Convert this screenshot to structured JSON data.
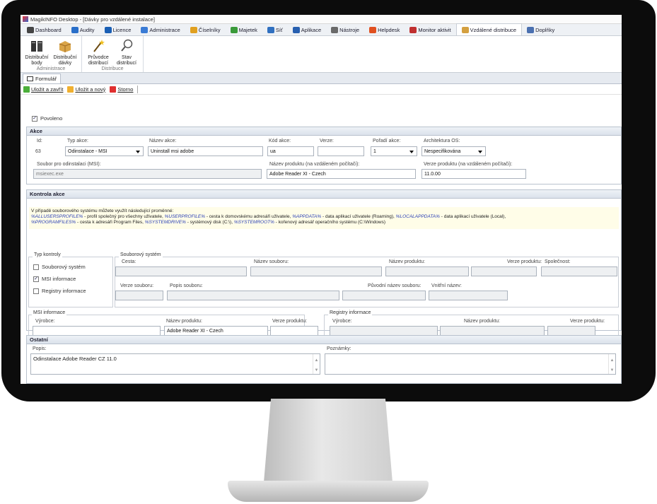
{
  "window": {
    "title": "MagikINFO Desktop - [Dávky pro vzdálené instalace]"
  },
  "tabs": [
    {
      "label": "Dashboard",
      "color": "#444444"
    },
    {
      "label": "Audity",
      "color": "#2a6fc9"
    },
    {
      "label": "Licence",
      "color": "#1a5fb4"
    },
    {
      "label": "Administrace",
      "color": "#3a7bd5"
    },
    {
      "label": "Číselníky",
      "color": "#e0a020"
    },
    {
      "label": "Majetek",
      "color": "#3a9a3a"
    },
    {
      "label": "Síť",
      "color": "#3070c0"
    },
    {
      "label": "Aplikace",
      "color": "#2860b0"
    },
    {
      "label": "Nástroje",
      "color": "#6a6a6a"
    },
    {
      "label": "Helpdesk",
      "color": "#e05020"
    },
    {
      "label": "Monitor aktivit",
      "color": "#c03030"
    },
    {
      "label": "Vzdálené distribuce",
      "color": "#d4a040"
    },
    {
      "label": "Doplňky",
      "color": "#4a70b0"
    }
  ],
  "active_tab": "Vzdálené distribuce",
  "ribbon": {
    "groups": [
      {
        "name": "Administrace",
        "buttons": [
          {
            "label": "Distribuční body",
            "icon": "server-icon"
          },
          {
            "label": "Distribuční dávky",
            "icon": "package-icon"
          }
        ]
      },
      {
        "name": "Distribuce",
        "buttons": [
          {
            "label": "Průvodce distribucí",
            "icon": "wand-icon"
          },
          {
            "label": "Stav distribucí",
            "icon": "magnifier-icon"
          }
        ]
      }
    ]
  },
  "doc_tab": "Formulář",
  "toolbar": {
    "save_close": "Uložit a zavřít",
    "save_new": "Uložit a nový",
    "cancel": "Storno"
  },
  "enabled": {
    "label": "Povoleno",
    "checked": true
  },
  "akce": {
    "header": "Akce",
    "labels": {
      "id": "Id:",
      "type": "Typ akce:",
      "name": "Název akce:",
      "code": "Kód akce:",
      "version": "Verze:",
      "order": "Pořadí akce:",
      "arch": "Architektura OS:",
      "msi_file": "Soubor pro odinstalaci (MSI):",
      "product_name": "Název produktu (na vzdáleném počítači):",
      "product_version": "Verze produktu (na vzdáleném počítači):"
    },
    "values": {
      "id": "63",
      "type": "Odinstalace - MSI",
      "name": "Uninstall msi adobe",
      "code": "ua",
      "version": "",
      "order": "1",
      "arch": "Nespecifikována",
      "msi_file": "msiexec.exe",
      "product_name": "Adobe Reader XI - Czech",
      "product_version": "11.0.00"
    }
  },
  "kontrola": {
    "header": "Kontrola akce",
    "note": {
      "line1": "V případě souborového systému můžete využít následující proměnné:",
      "v1": "%ALLUSERSPROFILE%",
      "t1": " - profil společný pro všechny uživatele, ",
      "v2": "%USERPROFILE%",
      "t2": " - cesta k domovskému adresáři uživatele, ",
      "v3": "%APPDATA%",
      "t3": " - data aplikací uživatele (Roaming), ",
      "v4": "%LOCALAPPDATA%",
      "t4": " - data aplikací uživatele (Local),",
      "v5": "%PROGRAMFILES%",
      "t5": " - cesta k adresáři Program Files, ",
      "v6": "%SYSTEMDRIVE%",
      "t6": " - systémový disk (C:\\), ",
      "v7": "%SYSTEMROOT%",
      "t7": " - kořenový adresář operačního systému (C:\\Windows)"
    },
    "typ_title": "Typ kontroly",
    "typ": [
      {
        "label": "Souborový systém",
        "checked": false
      },
      {
        "label": "MSI informace",
        "checked": true
      },
      {
        "label": "Registry informace",
        "checked": false
      }
    ],
    "fs": {
      "title": "Souborový systém",
      "path": "Cesta:",
      "file": "Název souboru:",
      "product": "Název produktu:",
      "prod_ver": "Verze produktu:",
      "company": "Společnost:",
      "file_ver": "Verze souboru:",
      "desc": "Popis souboru:",
      "orig": "Původní název souboru:",
      "internal": "Vnitřní název:"
    },
    "msi": {
      "title": "MSI informace",
      "vendor": "Výrobce:",
      "product": "Název produktu:",
      "prod_ver": "Verze produktu:",
      "vendor_value": "",
      "product_value": "Adobe Reader XI - Czech",
      "prod_ver_value": ""
    },
    "reg": {
      "title": "Registry informace",
      "vendor": "Výrobce:",
      "product": "Název produktu:",
      "prod_ver": "Verze produktu:"
    }
  },
  "ostatni": {
    "header": "Ostatní",
    "popis_label": "Popis:",
    "popis_value": "Odinstalace Adobe Reader CZ 11.0",
    "poznamky_label": "Poznámky:",
    "poznamky_value": ""
  }
}
